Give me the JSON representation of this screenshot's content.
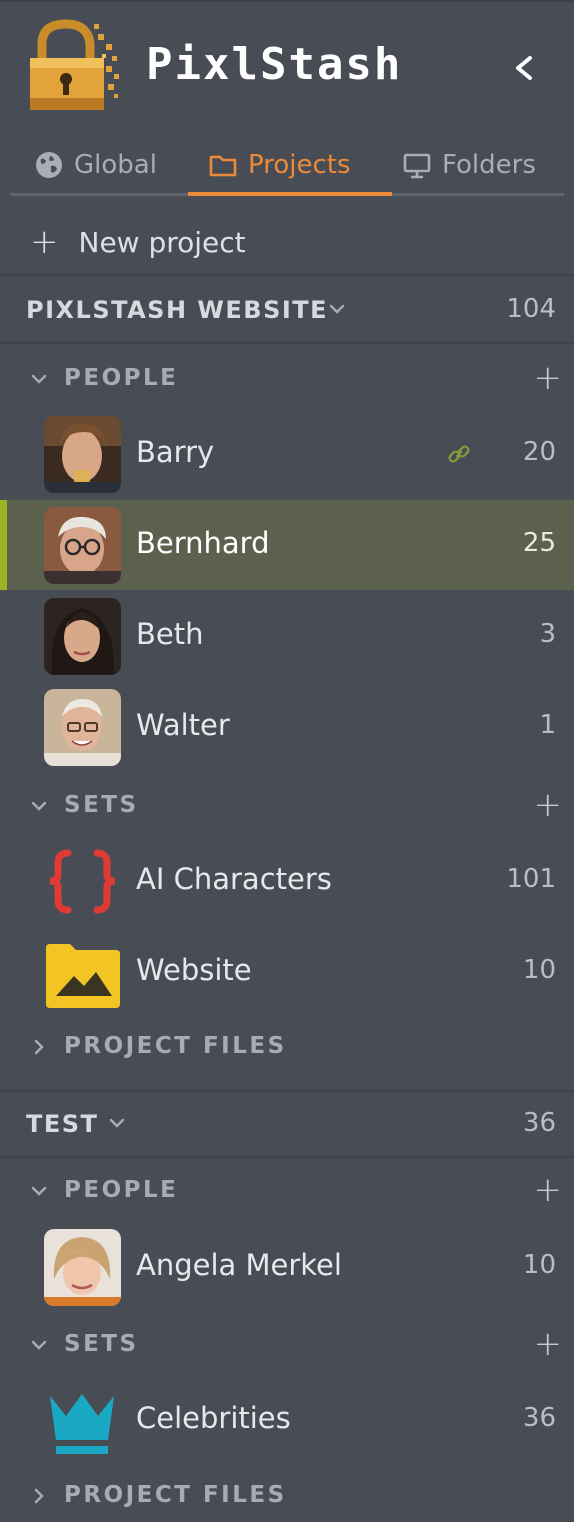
{
  "app": {
    "title": "PixlStash",
    "collapse_icon": "chevron-left-icon"
  },
  "tabs": [
    {
      "label": "Global",
      "icon": "globe-icon",
      "active": false
    },
    {
      "label": "Projects",
      "icon": "folder-icon",
      "active": true
    },
    {
      "label": "Folders",
      "icon": "monitor-icon",
      "active": false
    }
  ],
  "new_project_label": "New project",
  "projects": [
    {
      "name": "PIXLSTASH WEBSITE",
      "count": "104",
      "people": {
        "label": "PEOPLE",
        "items": [
          {
            "label": "Barry",
            "count": "20",
            "linked": true
          },
          {
            "label": "Bernhard",
            "count": "25",
            "selected": true
          },
          {
            "label": "Beth",
            "count": "3"
          },
          {
            "label": "Walter",
            "count": "1"
          }
        ]
      },
      "sets": {
        "label": "SETS",
        "items": [
          {
            "label": "AI Characters",
            "count": "101",
            "icon": "braces-icon"
          },
          {
            "label": "Website",
            "count": "10",
            "icon": "image-folder-icon"
          }
        ]
      },
      "files_label": "PROJECT FILES"
    },
    {
      "name": "TEST",
      "count": "36",
      "people": {
        "label": "PEOPLE",
        "items": [
          {
            "label": "Angela Merkel",
            "count": "10"
          }
        ]
      },
      "sets": {
        "label": "SETS",
        "items": [
          {
            "label": "Celebrities",
            "count": "36",
            "icon": "crown-icon"
          }
        ]
      },
      "files_label": "PROJECT FILES"
    }
  ],
  "colors": {
    "background": "#484d55",
    "accent": "#ed8a3a",
    "selected_bg": "#5b614c",
    "selected_bar": "#9cb324",
    "braces": "#e03a35",
    "folder": "#f2c525",
    "crown": "#1aa9c4"
  }
}
